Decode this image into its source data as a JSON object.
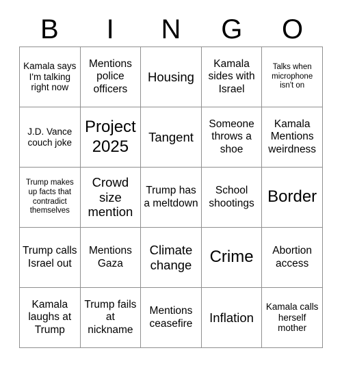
{
  "header": {
    "letters": [
      "B",
      "I",
      "N",
      "G",
      "O"
    ]
  },
  "grid": {
    "rows": [
      [
        {
          "text": "Kamala says I'm talking right now",
          "size": "sm"
        },
        {
          "text": "Mentions police officers",
          "size": "md"
        },
        {
          "text": "Housing",
          "size": "lg"
        },
        {
          "text": "Kamala sides with Israel",
          "size": "md"
        },
        {
          "text": "Talks when microphone isn't on",
          "size": "xs"
        }
      ],
      [
        {
          "text": "J.D. Vance couch joke",
          "size": "sm"
        },
        {
          "text": "Project 2025",
          "size": "xl"
        },
        {
          "text": "Tangent",
          "size": "lg"
        },
        {
          "text": "Someone throws a shoe",
          "size": "md"
        },
        {
          "text": "Kamala Mentions weirdness",
          "size": "md"
        }
      ],
      [
        {
          "text": "Trump makes up facts that contradict themselves",
          "size": "xs"
        },
        {
          "text": "Crowd size mention",
          "size": "lg"
        },
        {
          "text": "Trump has a meltdown",
          "size": "md"
        },
        {
          "text": "School shootings",
          "size": "md"
        },
        {
          "text": "Border",
          "size": "xl"
        }
      ],
      [
        {
          "text": "Trump calls Israel out",
          "size": "md"
        },
        {
          "text": "Mentions Gaza",
          "size": "md"
        },
        {
          "text": "Climate change",
          "size": "lg"
        },
        {
          "text": "Crime",
          "size": "xl"
        },
        {
          "text": "Abortion access",
          "size": "md"
        }
      ],
      [
        {
          "text": "Kamala laughs at Trump",
          "size": "md"
        },
        {
          "text": "Trump fails at nickname",
          "size": "md"
        },
        {
          "text": "Mentions ceasefire",
          "size": "md"
        },
        {
          "text": "Inflation",
          "size": "lg"
        },
        {
          "text": "Kamala calls herself mother",
          "size": "sm"
        }
      ]
    ]
  },
  "colors": {
    "border": "#8f8f8f",
    "text": "#000000",
    "background": "#ffffff"
  }
}
